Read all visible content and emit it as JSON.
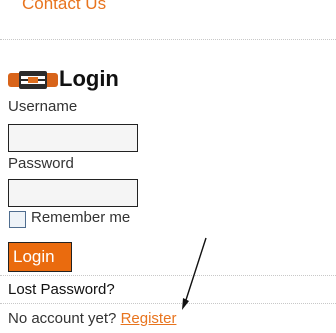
{
  "nav": {
    "contact_label": "Contact Us"
  },
  "login": {
    "title": "Login",
    "logo_icon": "harley-davidson-logo-icon",
    "username_label": "Username",
    "username_value": "",
    "password_label": "Password",
    "password_value": "",
    "remember_label": "Remember me",
    "remember_checked": false,
    "button_label": "Login",
    "lost_password_label": "Lost Password?",
    "no_account_text": "No account yet?",
    "register_label": "Register"
  },
  "annotation": {
    "arrow_icon": "arrow-pointer-icon"
  },
  "colors": {
    "accent": "#ea6b0e",
    "link": "#e8741e"
  }
}
